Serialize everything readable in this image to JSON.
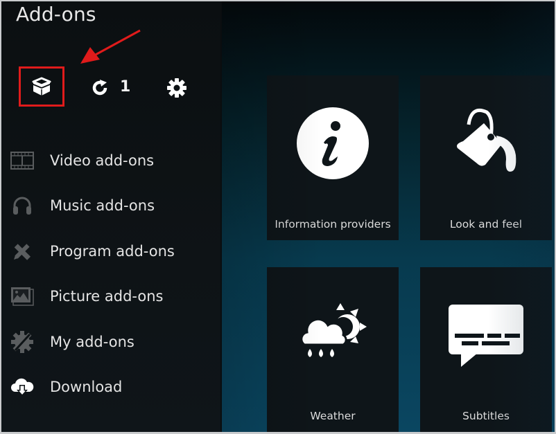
{
  "header": {
    "title": "Add-ons"
  },
  "toolbar": {
    "install_button_icon": "open-box-icon",
    "update_button_icon": "refresh-icon",
    "update_count": "1",
    "settings_button_icon": "gear-icon"
  },
  "annotation": {
    "highlight_color": "#e01b1b",
    "arrow_color": "#e01b1b"
  },
  "sidebar": {
    "items": [
      {
        "label": "Video add-ons",
        "icon": "film-strip-icon"
      },
      {
        "label": "Music add-ons",
        "icon": "headphones-icon"
      },
      {
        "label": "Program add-ons",
        "icon": "pencil-ruler-icon"
      },
      {
        "label": "Picture add-ons",
        "icon": "picture-icon"
      },
      {
        "label": "My add-ons",
        "icon": "gear-wrench-icon"
      },
      {
        "label": "Download",
        "icon": "cloud-download-icon"
      }
    ]
  },
  "tiles": [
    {
      "label": "Information providers",
      "icon": "info-icon"
    },
    {
      "label": "Look and feel",
      "icon": "paint-bucket-icon"
    },
    {
      "label": "Weather",
      "icon": "weather-icon"
    },
    {
      "label": "Subtitles",
      "icon": "subtitles-icon"
    }
  ]
}
